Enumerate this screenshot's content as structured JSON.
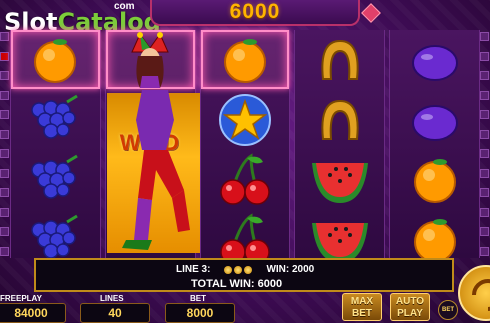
{
  "header": {
    "logo_slot": "Slot",
    "logo_catalog": "Catalog",
    "logo_com": "com",
    "top_value": "6000"
  },
  "reels": {
    "wild_label": "WILD",
    "symbols": [
      [
        "orange",
        "grapes",
        "grapes",
        "grapes"
      ],
      [
        "jester",
        "wild",
        "wild",
        "wild"
      ],
      [
        "orange",
        "star",
        "cherries",
        "cherries"
      ],
      [
        "horseshoe",
        "horseshoe",
        "watermelon",
        "watermelon"
      ],
      [
        "plum",
        "plum",
        "orange",
        "orange"
      ]
    ]
  },
  "win_info": {
    "line_label": "LINE 3:",
    "win_label": "WIN: 2000",
    "total_label": "TOTAL WIN: 6000"
  },
  "controls": {
    "freeplay_label": "FREEPLAY",
    "freeplay_value": "84000",
    "lines_label": "LINES",
    "lines_value": "40",
    "bet_label": "BET",
    "bet_value": "8000",
    "max_bet_top": "MAX",
    "max_bet_bottom": "BET",
    "auto_play_top": "AUTO",
    "auto_play_bottom": "PLAY",
    "bet_circle_label": "BET"
  },
  "line_ticks_left": [
    "3"
  ],
  "colors": {
    "accent": "#ffb400",
    "highlight": "#ff8ec8",
    "panel_border": "#c08b1a"
  }
}
